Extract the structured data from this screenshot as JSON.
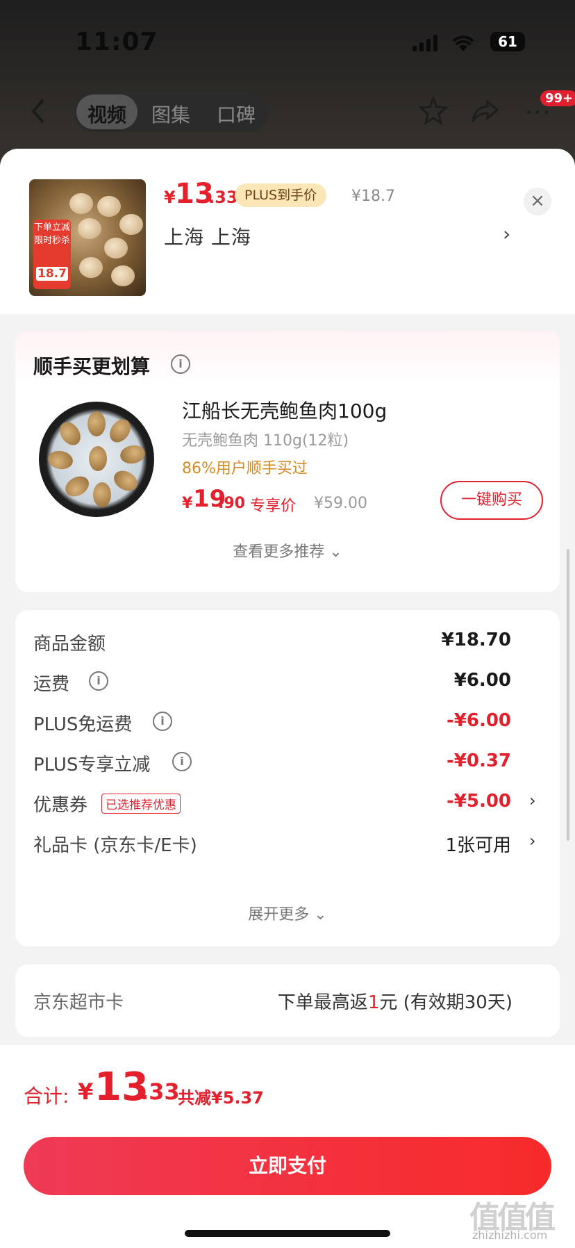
{
  "status_bar": {
    "time": "11:07",
    "battery": "61"
  },
  "nav": {
    "tabs": [
      {
        "label": "视频",
        "active": true
      },
      {
        "label": "图集",
        "active": false
      },
      {
        "label": "口碑",
        "active": false
      }
    ],
    "badge": "99+"
  },
  "header": {
    "price_symbol": "¥",
    "price_int": "13",
    "price_dec": ".33",
    "plus_label": "PLUS到手价",
    "orig_price": "¥18.7",
    "address": "上海  上海",
    "thumb_tag_top": "下单立减",
    "thumb_tag_sub": "限时秒杀",
    "thumb_tag_price": "18.7"
  },
  "recommend": {
    "title": "顺手买更划算",
    "product_name": "江船长无壳鲍鱼肉100g",
    "spec": "无壳鲍鱼肉 110g(12粒)",
    "bought": "86%用户顺手买过",
    "price_symbol": "¥",
    "price_int": "19",
    "price_dec": ".90",
    "exclusive_label": "专享价",
    "orig_price": "¥59.00",
    "buy_button": "一键购买",
    "more": "查看更多推荐 ⌄"
  },
  "summary": {
    "rows": [
      {
        "label": "商品金额",
        "value": "¥18.70",
        "info": false,
        "neg": false
      },
      {
        "label": "运费",
        "value": "¥6.00",
        "info": true,
        "neg": false
      },
      {
        "label": "PLUS免运费",
        "value": "-¥6.00",
        "info": true,
        "neg": true
      },
      {
        "label": "PLUS专享立减",
        "value": "-¥0.37",
        "info": true,
        "neg": true
      },
      {
        "label": "优惠券",
        "value": "-¥5.00",
        "tag": "已选推荐优惠",
        "neg": true,
        "chevron": true
      },
      {
        "label": "礼品卡 (京东卡/E卡)",
        "value": "1张可用",
        "neg": false,
        "chevron": true
      }
    ],
    "more": "展开更多 ⌄"
  },
  "supermarket_card": {
    "label": "京东超市卡",
    "value_prefix": "下单最高返",
    "value_num": "1",
    "value_suffix": "元 (有效期30天)"
  },
  "footer": {
    "total_label": "合计:",
    "total_symbol": "¥",
    "total_int": "13",
    "total_dec": ".33",
    "saved": "共减¥5.37",
    "pay_button": "立即支付"
  },
  "watermark": {
    "main": "值值值",
    "sub": "zhizhizhi.com"
  },
  "colors": {
    "accent_red": "#e4202d",
    "plus_gold": "#fae6b7"
  }
}
